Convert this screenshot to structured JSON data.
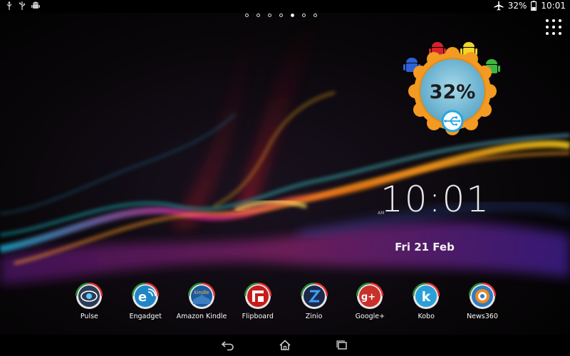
{
  "status_bar": {
    "left_icons": [
      "usb-debug-icon",
      "usb-icon",
      "android-icon"
    ],
    "airplane_icon": "airplane-icon",
    "battery_percent": "32%",
    "battery_icon": "battery-icon",
    "time": "10:01"
  },
  "home": {
    "page_count": 7,
    "active_page": 5
  },
  "battery_widget": {
    "percent": "32%",
    "charging_icon": "usb-icon",
    "colors": {
      "ring": "#f29a22",
      "face": "#7ec1dc",
      "blue": "#2c62d6",
      "red": "#d8222a",
      "yellow": "#f2d62b",
      "green": "#3db541"
    }
  },
  "clock_widget": {
    "time": "10:01",
    "ampm": "AM",
    "date": "Fri 21 Feb"
  },
  "dock": {
    "apps": [
      {
        "label": "Pulse",
        "icon": "pulse-icon"
      },
      {
        "label": "Engadget",
        "icon": "engadget-icon"
      },
      {
        "label": "Amazon Kindle",
        "icon": "kindle-icon"
      },
      {
        "label": "Flipboard",
        "icon": "flipboard-icon"
      },
      {
        "label": "Zinio",
        "icon": "zinio-icon"
      },
      {
        "label": "Google+",
        "icon": "google-plus-icon"
      },
      {
        "label": "Kobo",
        "icon": "kobo-icon"
      },
      {
        "label": "News360",
        "icon": "news360-icon"
      }
    ]
  },
  "nav_bar": {
    "buttons": [
      "back-icon",
      "home-icon",
      "recent-apps-icon"
    ]
  }
}
